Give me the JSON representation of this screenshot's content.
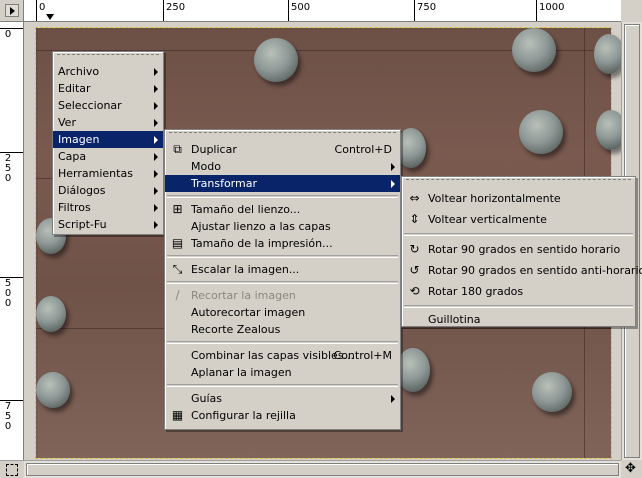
{
  "rulers": {
    "horizontal": [
      "0",
      "250",
      "500",
      "750",
      "1000"
    ],
    "vertical": [
      "0",
      "250",
      "500",
      "750"
    ]
  },
  "main_menu": {
    "items": [
      {
        "label": "Archivo",
        "submenu": true
      },
      {
        "label": "Editar",
        "submenu": true
      },
      {
        "label": "Seleccionar",
        "submenu": true
      },
      {
        "label": "Ver",
        "submenu": true
      },
      {
        "label": "Imagen",
        "submenu": true,
        "selected": true
      },
      {
        "label": "Capa",
        "submenu": true
      },
      {
        "label": "Herramientas",
        "submenu": true
      },
      {
        "label": "Diálogos",
        "submenu": true
      },
      {
        "label": "Filtros",
        "submenu": true
      },
      {
        "label": "Script-Fu",
        "submenu": true
      }
    ]
  },
  "image_menu": {
    "duplicate": {
      "label": "Duplicar",
      "accel": "Control+D"
    },
    "mode": {
      "label": "Modo"
    },
    "transform": {
      "label": "Transformar"
    },
    "canvas_size": {
      "label": "Tamaño del lienzo..."
    },
    "fit_canvas": {
      "label": "Ajustar lienzo a las capas"
    },
    "print_size": {
      "label": "Tamaño de la impresión..."
    },
    "scale": {
      "label": "Escalar la imagen..."
    },
    "crop": {
      "label": "Recortar la imagen"
    },
    "autocrop": {
      "label": "Autorecortar imagen"
    },
    "zealous": {
      "label": "Recorte Zealous"
    },
    "merge": {
      "label": "Combinar las capas visibles...",
      "accel": "Control+M"
    },
    "flatten": {
      "label": "Aplanar la imagen"
    },
    "guides": {
      "label": "Guías"
    },
    "grid": {
      "label": "Configurar la rejilla"
    }
  },
  "transform_menu": {
    "flip_h": "Voltear horizontalmente",
    "flip_v": "Voltear verticalmente",
    "rot_cw": "Rotar 90 grados en sentido horario",
    "rot_ccw": "Rotar 90 grados en sentido anti-horario",
    "rot_180": "Rotar 180 grados",
    "guillotine": "Guillotina"
  },
  "colors": {
    "selection": "#0a246a",
    "menu_bg": "#d4d0c8"
  }
}
